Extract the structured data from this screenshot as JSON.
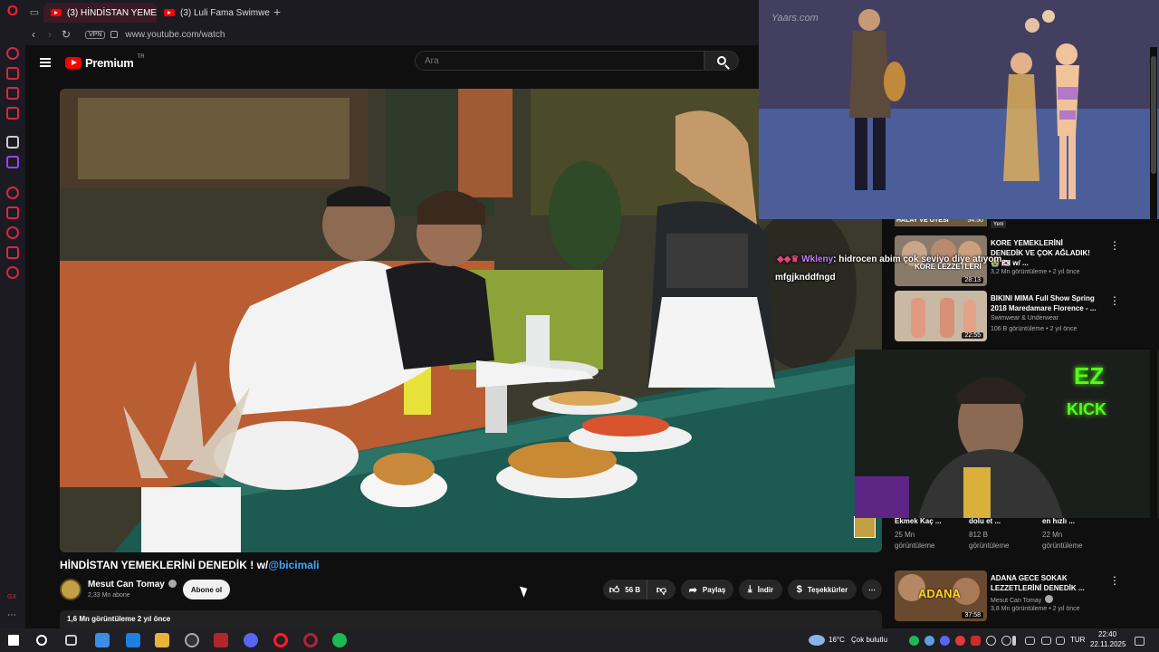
{
  "browser": {
    "tabs": [
      {
        "label": "(3) HİNDİSTAN YEME",
        "active": true
      },
      {
        "label": "(3) Luli Fama Swimwear F",
        "active": false
      }
    ],
    "new_tab": "+",
    "url": "www.youtube.com/watch",
    "vpn": "VPN"
  },
  "youtube": {
    "logo_text": "Premium",
    "logo_region": "TR",
    "search_placeholder": "Ara"
  },
  "video": {
    "title_main": "HİNDİSTAN YEMEKLERİNİ DENEDİK ! w/",
    "title_mention": "@bicimali",
    "channel": "Mesut Can Tomay",
    "subscribers": "2,33 Mn abone",
    "subscribe_label": "Abone ol",
    "likes": "56 B",
    "share_label": "Paylaş",
    "download_label": "İndir",
    "thanks_label": "Teşekkürler",
    "more": "⋯",
    "stats": "1,6 Mn görüntüleme  2 yıl önce"
  },
  "related": [
    {
      "title": "KORE YEMEKLERİNİ DENEDİK VE ÇOK AĞLADIK! 😭 🇰🇷 w/ ...",
      "meta": "3,2 Mn görüntüleme • 2 yıl önce",
      "duration": "28:13",
      "thumb_caption": "KORE LEZZETLERİ"
    },
    {
      "title": "BIKINI MIMA Full Show Spring 2018 Maredamare Florence - ...",
      "channel": "Swimwear & Underwear",
      "meta": "106 B görüntüleme • 2 yıl önce",
      "duration": "22:55"
    },
    {
      "title": "ADANA GECE SOKAK LEZZETLERİNİ DENEDİK ...",
      "channel": "Mesut Can Tomay",
      "meta": "3,8 Mn görüntüleme • 2 yıl önce",
      "duration": "37:58",
      "thumb_caption": "ADANA"
    }
  ],
  "partial_top": {
    "caption": "HALAY VE ÖTESİ",
    "duration": "54:50",
    "badge": "Yeni"
  },
  "shorts": [
    {
      "title": "Ekmek Kaç ...",
      "views": "25 Mn",
      "label": "görüntüleme"
    },
    {
      "title": "dolu et ...",
      "views": "812 B",
      "label": "görüntüleme"
    },
    {
      "title": "en hızlı ...",
      "views": "22 Mn",
      "label": "görüntüleme"
    }
  ],
  "overlay": {
    "pip_watermark": "Yaars.com",
    "chat_user": "Wkleny",
    "chat_message": ": hidrocen abim çok seviyo diye atıyom",
    "chat_line2": "mfgjknddfngd",
    "cam_logo_top": "EZ",
    "cam_logo_bottom": "KICK"
  },
  "taskbar": {
    "temperature": "16°C",
    "weather": "Çok bulutlu",
    "language": "TUR",
    "time": "22:40",
    "date": "22.11.2025"
  },
  "colors": {
    "accent": "#ff0000",
    "link": "#3ea6ff",
    "opera": "#ff1b2d",
    "kick_green": "#53fc18"
  }
}
